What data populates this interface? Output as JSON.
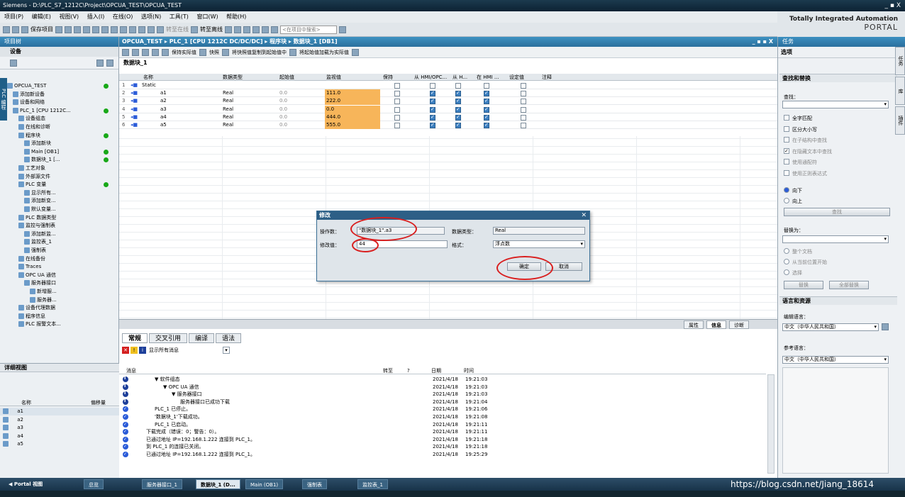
{
  "window": {
    "title": "Siemens - D:\\PLC_S7_1212C\\Project\\OPCUA_TEST\\OPCUA_TEST",
    "controls": "_ ▪ X"
  },
  "menu": [
    "项目(P)",
    "编辑(E)",
    "视图(V)",
    "插入(I)",
    "在线(O)",
    "选项(N)",
    "工具(T)",
    "窗口(W)",
    "帮助(H)"
  ],
  "toolbar": {
    "save_label": "保存项目",
    "go_online": "转至在线",
    "go_offline": "转至离线",
    "search_placeholder": "<在项目中搜索>"
  },
  "portal": {
    "brand": "Totally Integrated Automation",
    "sub": "PORTAL"
  },
  "left": {
    "header": "项目树",
    "devices_tab": "设备",
    "side_tab": "PLC 编程",
    "tree": [
      {
        "label": "OPCUA_TEST",
        "indent": 0,
        "ok": true
      },
      {
        "label": "添加新设备",
        "indent": 1
      },
      {
        "label": "设备和网络",
        "indent": 1
      },
      {
        "label": "PLC_1 [CPU 1212C...",
        "indent": 1,
        "ok": true
      },
      {
        "label": "设备组态",
        "indent": 2
      },
      {
        "label": "在线和诊断",
        "indent": 2
      },
      {
        "label": "程序块",
        "indent": 2,
        "ok": true
      },
      {
        "label": "添加新块",
        "indent": 3
      },
      {
        "label": "Main [OB1]",
        "indent": 3,
        "ok": true
      },
      {
        "label": "数据块_1 [...",
        "indent": 3,
        "ok": true
      },
      {
        "label": "工艺对象",
        "indent": 2
      },
      {
        "label": "外部源文件",
        "indent": 2
      },
      {
        "label": "PLC 变量",
        "indent": 2,
        "ok": true
      },
      {
        "label": "显示所有...",
        "indent": 3
      },
      {
        "label": "添加新变...",
        "indent": 3
      },
      {
        "label": "默认变量...",
        "indent": 3
      },
      {
        "label": "PLC 数据类型",
        "indent": 2
      },
      {
        "label": "监控与强制表",
        "indent": 2
      },
      {
        "label": "添加新监...",
        "indent": 3
      },
      {
        "label": "监控表_1",
        "indent": 3
      },
      {
        "label": "强制表",
        "indent": 3
      },
      {
        "label": "在线备份",
        "indent": 2
      },
      {
        "label": "Traces",
        "indent": 2
      },
      {
        "label": "OPC UA 通信",
        "indent": 2
      },
      {
        "label": "服务器接口",
        "indent": 3
      },
      {
        "label": "新增服...",
        "indent": 4
      },
      {
        "label": "服务器...",
        "indent": 4
      },
      {
        "label": "设备代理数据",
        "indent": 2
      },
      {
        "label": "程序信息",
        "indent": 2
      },
      {
        "label": "PLC 报警文本...",
        "indent": 2
      }
    ],
    "detail_header": "详细视图",
    "detail_cols": [
      "名称",
      "偏移量"
    ],
    "detail_items": [
      "a1",
      "a2",
      "a3",
      "a4",
      "a5"
    ]
  },
  "main": {
    "breadcrumb": "OPCUA_TEST ▸ PLC_1 [CPU 1212C DC/DC/DC] ▸ 程序块 ▸ 数据块_1 [DB1]",
    "breadcrumb_ctl": "_ ▪ ▪ X",
    "toolbar_texts": [
      "保持实际值",
      "快照",
      "将快照值复制到起始值中",
      "将起始值加载为实际值"
    ],
    "block_name": "数据块_1",
    "columns": [
      "名称",
      "数据类型",
      "起始值",
      "监视值",
      "保持",
      "从 HMI/OPC...",
      "从 H...",
      "在 HMI ...",
      "设定值",
      "注释"
    ],
    "rows": [
      {
        "no": "1",
        "name": "Static",
        "type": "",
        "start": "",
        "monitor": "",
        "checks": [
          false,
          false,
          false,
          false,
          false
        ]
      },
      {
        "no": "2",
        "name": "a1",
        "type": "Real",
        "start": "0.0",
        "monitor": "111.0",
        "checks": [
          false,
          true,
          true,
          true,
          false
        ]
      },
      {
        "no": "3",
        "name": "a2",
        "type": "Real",
        "start": "0.0",
        "monitor": "222.0",
        "checks": [
          false,
          true,
          true,
          true,
          false
        ]
      },
      {
        "no": "4",
        "name": "a3",
        "type": "Real",
        "start": "0.0",
        "monitor": "0.0",
        "checks": [
          false,
          true,
          true,
          true,
          false
        ]
      },
      {
        "no": "5",
        "name": "a4",
        "type": "Real",
        "start": "0.0",
        "monitor": "444.0",
        "checks": [
          false,
          true,
          true,
          true,
          false
        ]
      },
      {
        "no": "6",
        "name": "a5",
        "type": "Real",
        "start": "0.0",
        "monitor": "555.0",
        "checks": [
          false,
          true,
          true,
          true,
          false
        ]
      }
    ]
  },
  "dialog": {
    "title": "修改",
    "operand_label": "操作数：",
    "operand_value": "\"数据块_1\".a3",
    "datatype_label": "数据类型：",
    "datatype_value": "Real",
    "modify_label": "修改值：",
    "modify_value": "44",
    "format_label": "格式：",
    "format_value": "浮点数",
    "ok": "确定",
    "cancel": "取消"
  },
  "bottom": {
    "tabs_right": [
      "属性",
      "信息",
      "诊断"
    ],
    "subtabs": [
      "常规",
      "交叉引用",
      "编译",
      "语法"
    ],
    "filter": "显示所有消息",
    "cols": [
      "消息",
      "转至",
      "?",
      "日期",
      "时间"
    ],
    "messages": [
      {
        "icon": "info",
        "indent": 1,
        "text": "▼ 软件组态",
        "date": "2021/4/18",
        "time": "19:21:03"
      },
      {
        "icon": "info",
        "indent": 2,
        "text": "▼ OPC UA 通信",
        "date": "2021/4/18",
        "time": "19:21:03"
      },
      {
        "icon": "info",
        "indent": 3,
        "text": "▼ 服务器接口",
        "date": "2021/4/18",
        "time": "19:21:03"
      },
      {
        "icon": "info",
        "indent": 4,
        "text": "服务器接口已成功下载",
        "date": "2021/4/18",
        "time": "19:21:04"
      },
      {
        "icon": "ok",
        "indent": 1,
        "text": "PLC_1 已停止。",
        "date": "2021/4/18",
        "time": "19:21:06"
      },
      {
        "icon": "ok",
        "indent": 1,
        "text": "'数据块_1'下载成功。",
        "date": "2021/4/18",
        "time": "19:21:08"
      },
      {
        "icon": "ok",
        "indent": 1,
        "text": "PLC_1 已启动。",
        "date": "2021/4/18",
        "time": "19:21:11"
      },
      {
        "icon": "ok",
        "indent": 0,
        "text": "下载完成（错误：0；警告：0）。",
        "date": "2021/4/18",
        "time": "19:21:11"
      },
      {
        "icon": "ok",
        "indent": 0,
        "text": "已通过地址 IP=192.168.1.222 连接到 PLC_1。",
        "date": "2021/4/18",
        "time": "19:21:18"
      },
      {
        "icon": "ok",
        "indent": 0,
        "text": "到 PLC_1 的连接已关闭。",
        "date": "2021/4/18",
        "time": "19:21:18"
      },
      {
        "icon": "ok",
        "indent": 0,
        "text": "已通过地址 IP=192.168.1.222 连接到 PLC_1。",
        "date": "2021/4/18",
        "time": "19:25:29"
      }
    ]
  },
  "right": {
    "header": "任务",
    "options": "选项",
    "find_replace": "查找和替换",
    "find": "查找：",
    "checks": [
      "全字匹配",
      "区分大小写",
      "在子结构中查找",
      "在隐藏文本中查找",
      "使用通配符",
      "使用正则表达式"
    ],
    "dir_down": "向下",
    "dir_up": "向上",
    "find_btn": "查找",
    "replace_with": "替换为：",
    "scope": [
      "整个文档",
      "从当前位置开始",
      "选择"
    ],
    "replace_btn": "替换",
    "replace_all_btn": "全部替换",
    "lang_res": "语言和资源",
    "edit_lang": "编辑语言：",
    "edit_lang_value": "中文（中华人民共和国）",
    "ref_lang": "参考语言：",
    "ref_lang_value": "中文（中华人民共和国）",
    "side_tabs": [
      "任务",
      "库",
      "插件"
    ]
  },
  "taskbar": {
    "portal_view": "◀ Portal 视图",
    "overview": "总览",
    "items": [
      "服务器接口_1",
      "数据块_1 (D...",
      "Main (OB1)",
      "强制表",
      "监控表_1"
    ],
    "watermark": "https://blog.csdn.net/Jiang_18614"
  }
}
